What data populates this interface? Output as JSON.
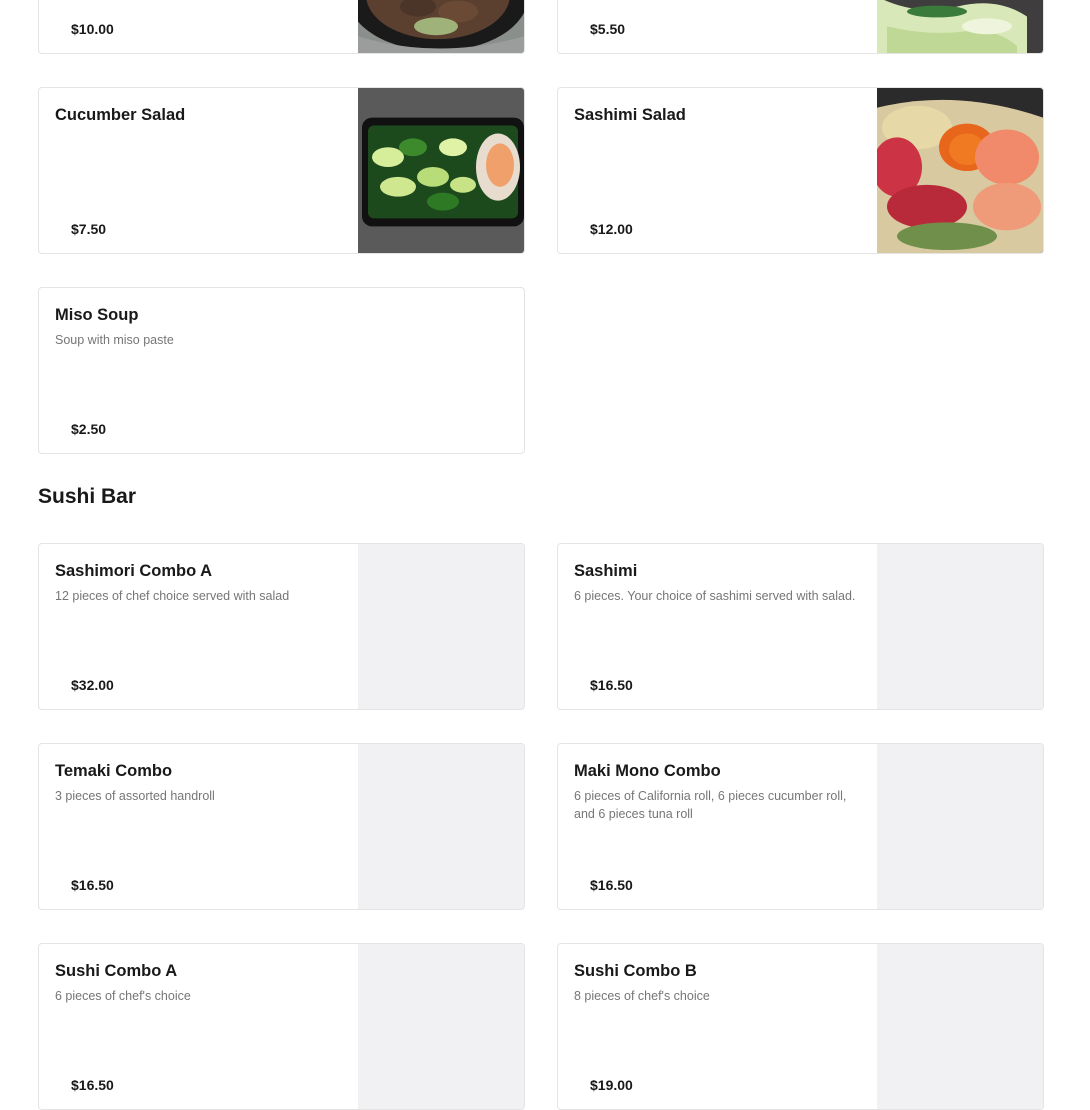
{
  "top_items": [
    {
      "price": "$10.00",
      "image": "soup-bowl-photo"
    },
    {
      "price": "$5.50",
      "image": "salad-photo"
    }
  ],
  "salads_soups": [
    {
      "name": "Cucumber Salad",
      "description": "",
      "price": "$7.50",
      "image": "cucumber-salad-photo"
    },
    {
      "name": "Sashimi Salad",
      "description": "",
      "price": "$12.00",
      "image": "sashimi-salad-photo"
    },
    {
      "name": "Miso Soup",
      "description": "Soup with miso paste",
      "price": "$2.50",
      "image": ""
    }
  ],
  "sushi_bar": {
    "title": "Sushi Bar",
    "items": [
      {
        "name": "Sashimori Combo A",
        "description": "12 pieces of chef choice served with salad",
        "price": "$32.00"
      },
      {
        "name": "Sashimi",
        "description": "6 pieces. Your choice of sashimi served with salad.",
        "price": "$16.50"
      },
      {
        "name": "Temaki Combo",
        "description": "3 pieces of assorted handroll",
        "price": "$16.50"
      },
      {
        "name": "Maki Mono Combo",
        "description": "6 pieces of California roll, 6 pieces cucumber roll, and 6 pieces tuna roll",
        "price": "$16.50"
      },
      {
        "name": "Sushi Combo A",
        "description": "6 pieces of chef's choice",
        "price": "$16.50"
      },
      {
        "name": "Sushi Combo B",
        "description": "8 pieces of chef's choice",
        "price": "$19.00"
      }
    ]
  },
  "colors": {
    "card_border": "#e4e4e4",
    "placeholder": "#f1f1f3",
    "text": "#191919",
    "muted": "#767676"
  }
}
